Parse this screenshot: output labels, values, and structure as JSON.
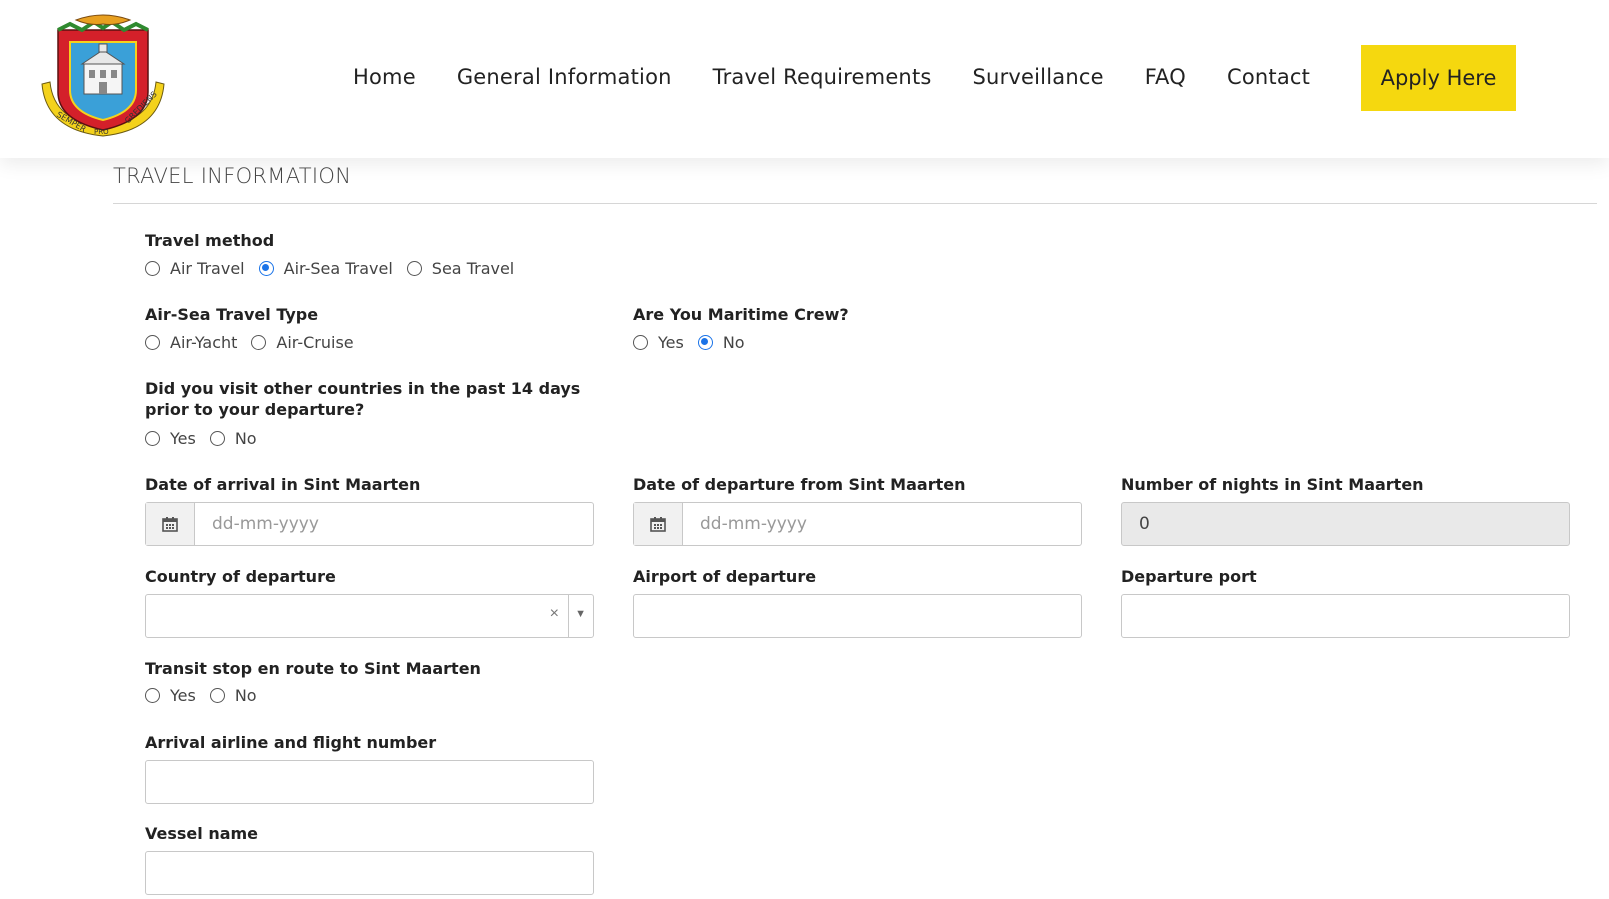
{
  "header": {
    "logo_alt": "Sint Maarten coat of arms",
    "logo_motto": [
      "SEMPER",
      "PRO",
      "GREDIENS"
    ],
    "nav": [
      "Home",
      "General Information",
      "Travel Requirements",
      "Surveillance",
      "FAQ",
      "Contact"
    ],
    "apply_label": "Apply Here",
    "accent": "#f5d80f"
  },
  "section_title": "TRAVEL INFORMATION",
  "form": {
    "travel_method": {
      "label": "Travel method",
      "options": [
        "Air Travel",
        "Air-Sea Travel",
        "Sea Travel"
      ],
      "selected": "Air-Sea Travel"
    },
    "air_sea_type": {
      "label": "Air-Sea Travel Type",
      "options": [
        "Air-Yacht",
        "Air-Cruise"
      ],
      "selected": null
    },
    "maritime_crew": {
      "label": "Are You Maritime Crew?",
      "options": [
        "Yes",
        "No"
      ],
      "selected": "No"
    },
    "visited_countries": {
      "label": "Did you visit other countries in the past 14 days prior to your departure?",
      "options": [
        "Yes",
        "No"
      ],
      "selected": null
    },
    "arrival_date": {
      "label": "Date of arrival in Sint Maarten",
      "placeholder": "dd-mm-yyyy"
    },
    "departure_date": {
      "label": "Date of departure from Sint Maarten",
      "placeholder": "dd-mm-yyyy"
    },
    "nights": {
      "label": "Number of nights in Sint Maarten",
      "value": "0"
    },
    "country_departure": {
      "label": "Country of departure",
      "clear_symbol": "×",
      "caret_symbol": "▼"
    },
    "airport_departure": {
      "label": "Airport of departure",
      "value": ""
    },
    "departure_port": {
      "label": "Departure port",
      "value": ""
    },
    "transit_stop": {
      "label": "Transit stop en route to Sint Maarten",
      "options": [
        "Yes",
        "No"
      ],
      "selected": null
    },
    "arrival_flight": {
      "label": "Arrival airline and flight number",
      "value": ""
    },
    "vessel_name": {
      "label": "Vessel name",
      "value": ""
    }
  },
  "colors": {
    "radio_selected": "#1a73e8",
    "border": "#c8c8c8",
    "disabled_bg": "#e9e9e9"
  }
}
